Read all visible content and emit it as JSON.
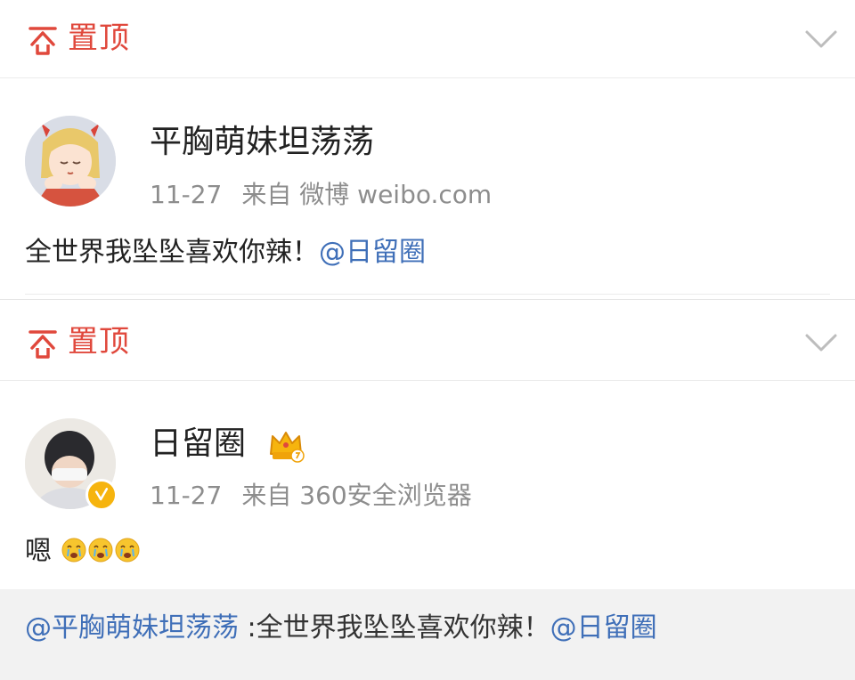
{
  "pinned_label": "置顶",
  "post1": {
    "username": "平胸萌妹坦荡荡",
    "date": "11-27",
    "source": "来自 微博 weibo.com",
    "text": "全世界我坠坠喜欢你辣！",
    "mention": "@日留圈"
  },
  "post2": {
    "username": "日留圈",
    "date": "11-27",
    "source": "来自 360安全浏览器",
    "text": "嗯",
    "emojis": [
      "crying-face",
      "crying-face",
      "crying-face"
    ]
  },
  "repost": {
    "author_mention": "@平胸萌妹坦荡荡",
    "text": " :全世界我坠坠喜欢你辣！",
    "mention": "@日留圈"
  },
  "colors": {
    "accent_red": "#e0483c",
    "link_blue": "#3f6fb8",
    "meta_gray": "#8d8d8d",
    "verified_gold": "#f6b40e"
  }
}
